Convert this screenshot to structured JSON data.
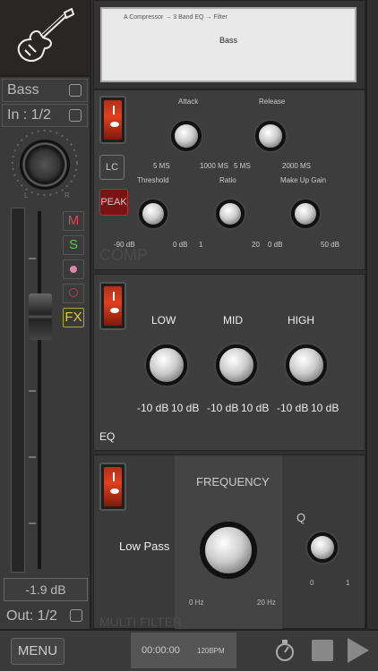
{
  "channel": {
    "instrument_icon": "electric-guitar-icon",
    "name": "Bass",
    "input": "In : 1/2",
    "pan_left": "L",
    "pan_right": "R",
    "mute": "M",
    "solo": "S",
    "fx": "FX",
    "volume": "-1.9 dB",
    "output": "Out: 1/2"
  },
  "preset": {
    "chain": "A Compressor → 3 Band EQ → Filter",
    "name": "Bass"
  },
  "comp": {
    "attack": "Attack",
    "release": "Release",
    "attack_min": "5 MS",
    "attack_max": "1000 MS",
    "release_min": "5 MS",
    "release_max": "2000 MS",
    "lc": "LC",
    "peak": "PEAK",
    "threshold": "Threshold",
    "ratio": "Ratio",
    "makeup": "Make Up Gain",
    "thr_min": "-90 dB",
    "thr_max": "0 dB",
    "ratio_min": "1",
    "ratio_max": "20",
    "mug_min": "0 dB",
    "mug_max": "50 dB",
    "watermark": "COMP"
  },
  "eq": {
    "low": "LOW",
    "mid": "MID",
    "high": "HIGH",
    "min": "-10 dB",
    "max": "10 dB",
    "title": "EQ"
  },
  "filter": {
    "frequency": "FREQUENCY",
    "type": "Low Pass",
    "freq_min": "0 Hz",
    "freq_max": "20 Hz",
    "q": "Q",
    "q_min": "0",
    "q_max": "1",
    "watermark": "MULTI FILTER"
  },
  "transport": {
    "menu": "MENU",
    "time": "00:00:00",
    "bpm": "120BPM"
  }
}
